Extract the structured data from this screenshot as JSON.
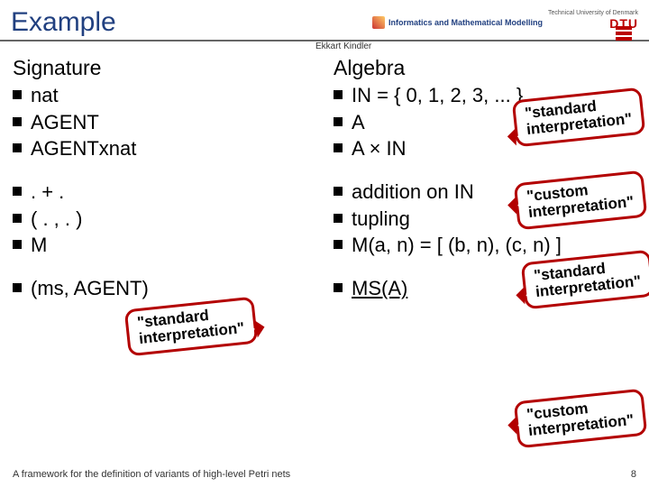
{
  "header": {
    "title": "Example",
    "author": "Ekkart Kindler",
    "dept": "Informatics and Mathematical Modelling",
    "uni": "Technical University of Denmark",
    "dtu": "DTU"
  },
  "left": {
    "heading": "Signature",
    "group1": [
      "nat",
      "AGENT",
      "AGENTxnat"
    ],
    "group2": [
      ". + .",
      "( . , . )",
      "M"
    ],
    "group3": [
      "(ms, AGENT)"
    ]
  },
  "right": {
    "heading": "Algebra",
    "group1": [
      "IN = { 0, 1, 2, 3, ... }",
      "A",
      "A × IN"
    ],
    "group2": [
      "addition on IN",
      "tupling",
      "M(a, n) = [ (b, n), (c, n) ]"
    ],
    "group3": [
      "MS(A)"
    ]
  },
  "callouts": {
    "std": "\"standard\ninterpretation\"",
    "cust": "\"custom\ninterpretation\""
  },
  "footer": {
    "text": "A framework for the definition of variants of high-level Petri nets",
    "page": "8"
  }
}
